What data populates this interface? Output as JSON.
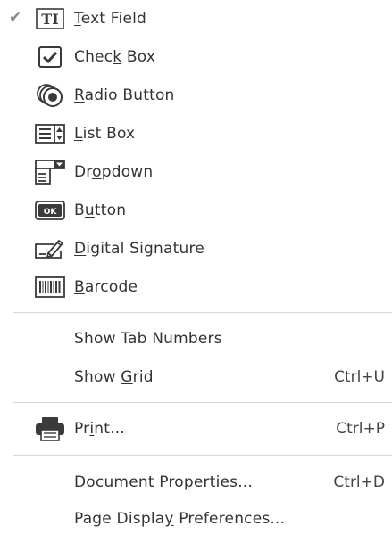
{
  "menu": {
    "form_fields": [
      {
        "pre": "",
        "key": "T",
        "post": "ext Field",
        "checked": true,
        "icon": "text-field-icon"
      },
      {
        "pre": "Chec",
        "key": "k",
        "post": " Box",
        "checked": false,
        "icon": "check-box-icon"
      },
      {
        "pre": "",
        "key": "R",
        "post": "adio Button",
        "checked": false,
        "icon": "radio-button-icon"
      },
      {
        "pre": "",
        "key": "L",
        "post": "ist Box",
        "checked": false,
        "icon": "list-box-icon"
      },
      {
        "pre": "Dr",
        "key": "o",
        "post": "pdown",
        "checked": false,
        "icon": "dropdown-icon"
      },
      {
        "pre": "B",
        "key": "u",
        "post": "tton",
        "checked": false,
        "icon": "button-icon"
      },
      {
        "pre": "",
        "key": "D",
        "post": "igital Signature",
        "checked": false,
        "icon": "digital-signature-icon"
      },
      {
        "pre": "",
        "key": "B",
        "post": "arcode",
        "checked": false,
        "icon": "barcode-icon"
      }
    ],
    "checkmark": "✔",
    "button_icon_text": "OK",
    "show_tab_numbers": {
      "label": "Show Tab Numbers"
    },
    "show_grid": {
      "pre": "Show ",
      "key": "G",
      "post": "rid",
      "shortcut": "Ctrl+U"
    },
    "print": {
      "pre": "Pr",
      "key": "i",
      "post": "nt...",
      "shortcut": "Ctrl+P",
      "icon": "printer-icon"
    },
    "document_properties": {
      "pre": "Do",
      "key": "c",
      "post": "ument Properties...",
      "shortcut": "Ctrl+D"
    },
    "page_display_preferences": {
      "pre": "Page Displa",
      "key": "y",
      "post": " Preferences..."
    }
  }
}
